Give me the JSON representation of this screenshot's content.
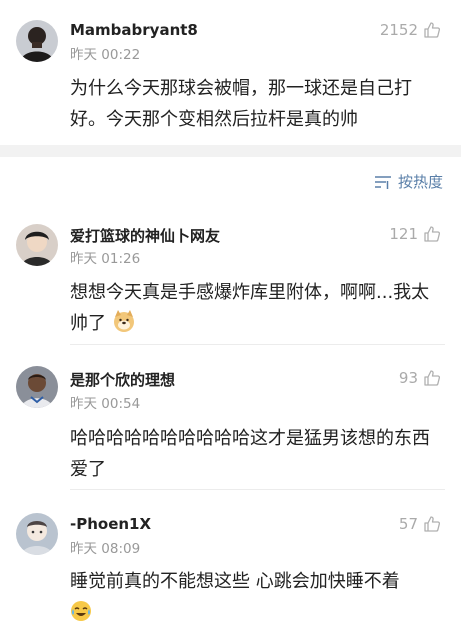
{
  "top_comment": {
    "username": "Mambabryant8",
    "time": "昨天 00:22",
    "likes": "2152",
    "text": "为什么今天那球会被帽，那一球还是自己打好。今天那个变相然后拉杆是真的帅",
    "avatar_icon": "user-avatar-dark"
  },
  "sort": {
    "label": "按热度",
    "icon": "sort-lines-icon"
  },
  "comments": [
    {
      "username": "爱打篮球的神仙卜网友",
      "time": "昨天 01:26",
      "likes": "121",
      "text": "想想今天真是手感爆炸库里附体，啊啊...我太帅了",
      "emoji": "doge-emoji"
    },
    {
      "username": "是那个欣的理想",
      "time": "昨天 00:54",
      "likes": "93",
      "text": "哈哈哈哈哈哈哈哈哈哈这才是猛男该想的东西 爱了"
    },
    {
      "username": "-Phoen1X",
      "time": "昨天 08:09",
      "likes": "57",
      "text": "睡觉前真的不能想这些 心跳会加快睡不着",
      "emoji": "crying-laughing-emoji"
    }
  ],
  "colors": {
    "link_blue": "#5a7fa8",
    "meta_gray": "#999999",
    "separator": "#f2f2f2"
  }
}
